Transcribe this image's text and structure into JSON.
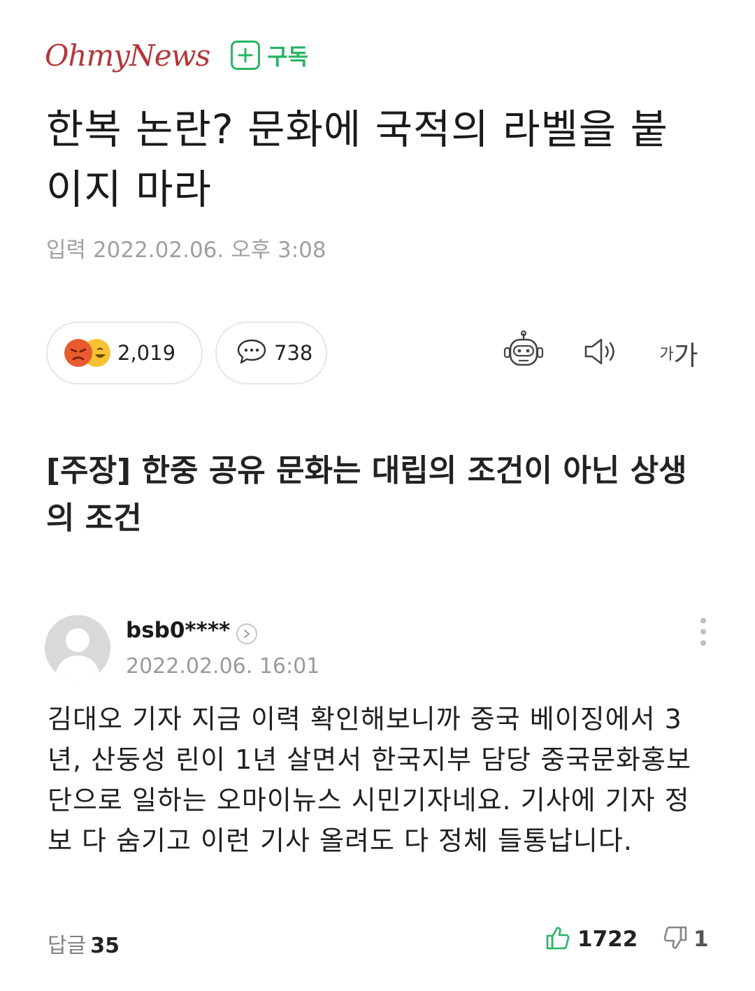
{
  "header": {
    "logo_text": "OhmyNews",
    "subscribe_label": "구독",
    "brand_color": "#b3363a",
    "subscribe_color": "#27b566"
  },
  "article": {
    "title": "한복 논란? 문화에 국적의 라벨을 붙이지 마라",
    "date": "입력 2022.02.06. 오후 3:08",
    "subtitle": "[주장] 한중 공유 문화는 대립의 조건이 아닌 상생의 조건"
  },
  "toolbar": {
    "reaction_count": "2,019",
    "comment_count": "738",
    "font_small_label": "가",
    "font_large_label": "가",
    "icons": [
      "angry-emoji-icon",
      "laugh-emoji-icon",
      "comment-bubble-icon",
      "robot-icon",
      "speaker-icon"
    ]
  },
  "comment": {
    "username": "bsb0****",
    "date": "2022.02.06. 16:01",
    "body": "김대오 기자 지금 이력 확인해보니까 중국 베이징에서 3년, 산둥성 린이 1년 살면서 한국지부 담당 중국문화홍보단으로 일하는 오마이뉴스 시민기자네요. 기사에 기자 정보 다 숨기고 이런 기사 올려도 다 정체 들통납니다.",
    "reply_label": "답글",
    "reply_count": "35",
    "like_count": "1722",
    "dislike_count": "1",
    "like_color": "#27b566"
  }
}
